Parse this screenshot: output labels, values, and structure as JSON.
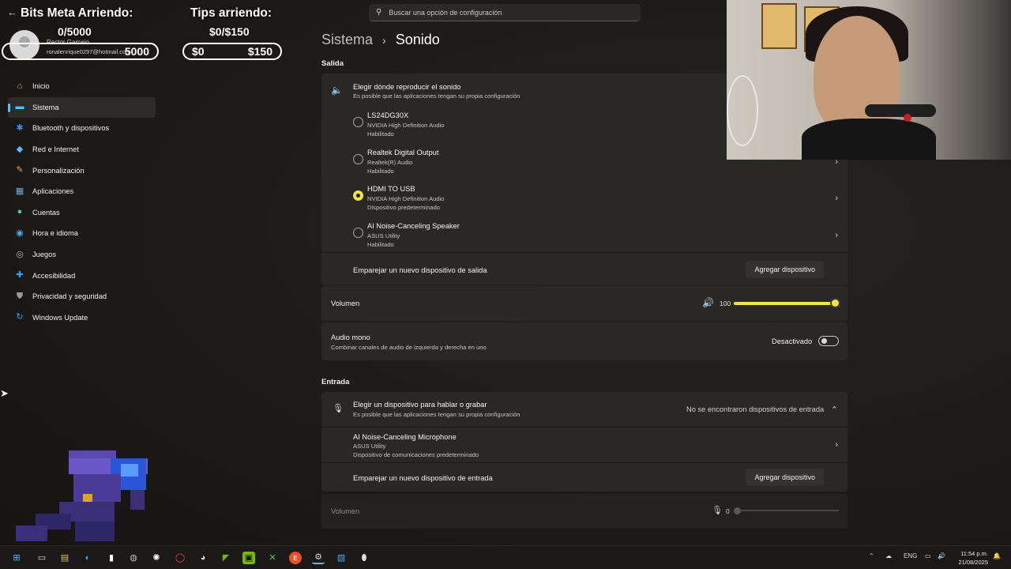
{
  "overlay": {
    "bits_title": "Bits Meta Arriendo:",
    "bits_progress": "0/5000",
    "bits_bar_right": "5000",
    "tips_title": "Tips arriendo:",
    "tips_progress": "$0/$150",
    "tips_bar_left": "$0",
    "tips_bar_right": "$150"
  },
  "user": {
    "name": "Rector Gamaio",
    "email": "ronalenrique0297@hotmail.com"
  },
  "search": {
    "placeholder": "Buscar una opción de configuración"
  },
  "breadcrumb": {
    "parent": "Sistema",
    "separator": "›",
    "current": "Sonido"
  },
  "sidebar": {
    "items": [
      {
        "label": "Inicio",
        "icon": "home-icon",
        "glyph": "⌂",
        "color": "#e8a04a"
      },
      {
        "label": "Sistema",
        "icon": "system-monitor-icon",
        "glyph": "▬",
        "color": "#4cc2ff"
      },
      {
        "label": "Bluetooth y dispositivos",
        "icon": "bluetooth-icon",
        "glyph": "✱",
        "color": "#3a8ee6"
      },
      {
        "label": "Red e Internet",
        "icon": "wifi-icon",
        "glyph": "◆",
        "color": "#5cb8ff"
      },
      {
        "label": "Personalización",
        "icon": "paintbrush-icon",
        "glyph": "✎",
        "color": "#e8a060"
      },
      {
        "label": "Aplicaciones",
        "icon": "apps-icon",
        "glyph": "▦",
        "color": "#7aa7d8"
      },
      {
        "label": "Cuentas",
        "icon": "account-icon",
        "glyph": "●",
        "color": "#3ecf8e"
      },
      {
        "label": "Hora e idioma",
        "icon": "globe-clock-icon",
        "glyph": "◉",
        "color": "#4aa8f0"
      },
      {
        "label": "Juegos",
        "icon": "gamepad-icon",
        "glyph": "◎",
        "color": "#b0b0b0"
      },
      {
        "label": "Accesibilidad",
        "icon": "accessibility-icon",
        "glyph": "✚",
        "color": "#3aa0f0"
      },
      {
        "label": "Privacidad y seguridad",
        "icon": "shield-icon",
        "glyph": "⛊",
        "color": "#9a9a9a"
      },
      {
        "label": "Windows Update",
        "icon": "update-icon",
        "glyph": "↻",
        "color": "#3aa0f0"
      }
    ],
    "active_index": 1
  },
  "output": {
    "section_label": "Salida",
    "header_title": "Elegir dónde reproducir el sonido",
    "header_sub": "Es posible que las aplicaciones tengan su propia configuración",
    "devices": [
      {
        "name": "LS24DG30X",
        "driver": "NVIDIA High Definition Audio",
        "status": "Habilitado",
        "selected": false
      },
      {
        "name": "Realtek Digital Output",
        "driver": "Realtek(R) Audio",
        "status": "Habilitado",
        "selected": false
      },
      {
        "name": "HDMI TO USB",
        "driver": "NVIDIA High Definition Audio",
        "status": "Dispositivo predeterminado",
        "selected": true
      },
      {
        "name": "AI Noise-Canceling Speaker",
        "driver": "ASUS Utility",
        "status": "Habilitado",
        "selected": false
      }
    ],
    "pair_label": "Emparejar un nuevo dispositivo de salida",
    "add_button": "Agregar dispositivo",
    "volume_label": "Volumen",
    "volume_value": "100",
    "volume_fraction": 1.0,
    "mono_title": "Audio mono",
    "mono_sub": "Combinar canales de audio de izquierda y derecha en uno",
    "mono_state": "Desactivado"
  },
  "input": {
    "section_label": "Entrada",
    "header_title": "Elegir un dispositivo para hablar o grabar",
    "header_sub": "Es posible que las aplicaciones tengan su propia configuración",
    "header_status": "No se encontraron dispositivos de entrada",
    "device_name": "AI Noise-Canceling Microphone",
    "device_driver": "ASUS Utility",
    "device_status": "Dispositivo de comunicaciones predeterminado",
    "pair_label": "Emparejar un nuevo dispositivo de entrada",
    "add_button": "Agregar dispositivo",
    "volume_label": "Volumen",
    "volume_value": "0",
    "volume_fraction": 0.0
  },
  "taskbar": {
    "tray_lang": "ENG",
    "time": "11:54 p.m.",
    "date": "21/08/2025"
  },
  "colors": {
    "accent": "#4cc2ff",
    "highlight_yellow": "#f0e24a"
  }
}
